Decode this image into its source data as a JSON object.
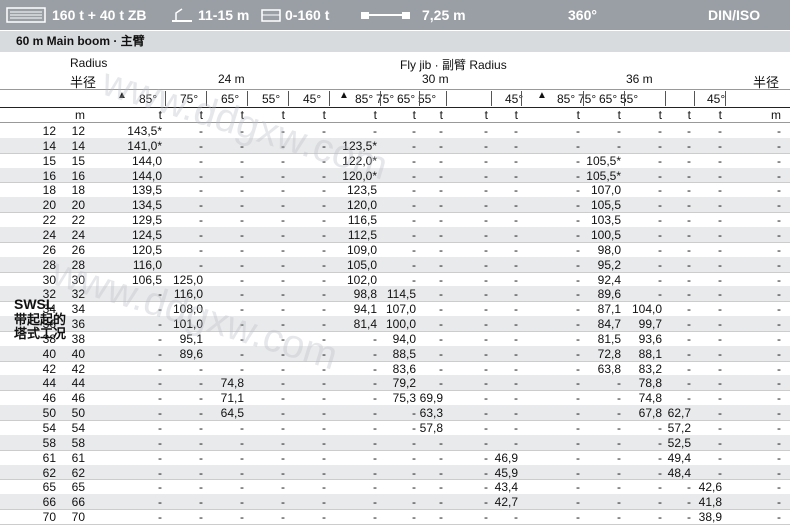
{
  "header": {
    "capacity": "160 t + 40 t ZB",
    "counterweight_range": "11-15 m",
    "ballast": "0-160 t",
    "outrigger": "7,25 m",
    "slew": "360°",
    "standard": "DIN/ISO"
  },
  "subheader": {
    "boom": "60 m   Main boom · 主臂"
  },
  "table": {
    "radius_label_en": "Radius",
    "radius_label_cn": "半径",
    "radius_label_cn_right": "半径",
    "flyjib_label": "Fly jib · 副臂 Radius",
    "groups": [
      "24 m",
      "30 m",
      "36 m"
    ],
    "angles_24": [
      "85°",
      "75°",
      "65°",
      "55°",
      "45°"
    ],
    "angles_30": [
      "85°",
      "75°",
      "65°",
      "55°",
      "45°"
    ],
    "angles_36": [
      "85°",
      "75°",
      "65°",
      "55°",
      "45°"
    ],
    "unit_left": "m",
    "unit_right": "m",
    "unit_t": "t",
    "swsl": "SWSL",
    "swsl_cn1": "带起起的",
    "swsl_cn2": "塔式工况",
    "rows": [
      [
        "12",
        "143,5*",
        "-",
        "-",
        "-",
        "-",
        "-",
        "-",
        "-",
        "-",
        "-",
        "-",
        "-",
        "-",
        "-",
        "-",
        "-",
        "12"
      ],
      [
        "14",
        "141,0*",
        "-",
        "-",
        "-",
        "-",
        "123,5*",
        "-",
        "-",
        "-",
        "-",
        "-",
        "-",
        "-",
        "-",
        "-",
        "-",
        "14"
      ],
      [
        "15",
        "144,0",
        "-",
        "-",
        "-",
        "-",
        "122,0*",
        "-",
        "-",
        "-",
        "-",
        "-",
        "105,5*",
        "-",
        "-",
        "-",
        "-",
        "15"
      ],
      [
        "16",
        "144,0",
        "-",
        "-",
        "-",
        "-",
        "120,0*",
        "-",
        "-",
        "-",
        "-",
        "-",
        "105,5*",
        "-",
        "-",
        "-",
        "-",
        "16"
      ],
      [
        "18",
        "139,5",
        "-",
        "-",
        "-",
        "-",
        "123,5",
        "-",
        "-",
        "-",
        "-",
        "-",
        "107,0",
        "-",
        "-",
        "-",
        "-",
        "18"
      ],
      [
        "20",
        "134,5",
        "-",
        "-",
        "-",
        "-",
        "120,0",
        "-",
        "-",
        "-",
        "-",
        "-",
        "105,5",
        "-",
        "-",
        "-",
        "-",
        "20"
      ],
      [
        "22",
        "129,5",
        "-",
        "-",
        "-",
        "-",
        "116,5",
        "-",
        "-",
        "-",
        "-",
        "-",
        "103,5",
        "-",
        "-",
        "-",
        "-",
        "22"
      ],
      [
        "24",
        "124,5",
        "-",
        "-",
        "-",
        "-",
        "112,5",
        "-",
        "-",
        "-",
        "-",
        "-",
        "100,5",
        "-",
        "-",
        "-",
        "-",
        "24"
      ],
      [
        "26",
        "120,5",
        "-",
        "-",
        "-",
        "-",
        "109,0",
        "-",
        "-",
        "-",
        "-",
        "-",
        "98,0",
        "-",
        "-",
        "-",
        "-",
        "26"
      ],
      [
        "28",
        "116,0",
        "-",
        "-",
        "-",
        "-",
        "105,0",
        "-",
        "-",
        "-",
        "-",
        "-",
        "95,2",
        "-",
        "-",
        "-",
        "-",
        "28"
      ],
      [
        "30",
        "106,5",
        "125,0",
        "-",
        "-",
        "-",
        "102,0",
        "-",
        "-",
        "-",
        "-",
        "-",
        "92,4",
        "-",
        "-",
        "-",
        "-",
        "30"
      ],
      [
        "32",
        "-",
        "116,0",
        "-",
        "-",
        "-",
        "98,8",
        "114,5",
        "-",
        "-",
        "-",
        "-",
        "89,6",
        "-",
        "-",
        "-",
        "-",
        "32"
      ],
      [
        "34",
        "-",
        "108,0",
        "-",
        "-",
        "-",
        "94,1",
        "107,0",
        "-",
        "-",
        "-",
        "-",
        "87,1",
        "104,0",
        "-",
        "-",
        "-",
        "34"
      ],
      [
        "36",
        "-",
        "101,0",
        "-",
        "-",
        "-",
        "81,4",
        "100,0",
        "-",
        "-",
        "-",
        "-",
        "84,7",
        "99,7",
        "-",
        "-",
        "-",
        "36"
      ],
      [
        "38",
        "-",
        "95,1",
        "-",
        "-",
        "-",
        "-",
        "94,0",
        "-",
        "-",
        "-",
        "-",
        "81,5",
        "93,6",
        "-",
        "-",
        "-",
        "38"
      ],
      [
        "40",
        "-",
        "89,6",
        "-",
        "-",
        "-",
        "-",
        "88,5",
        "-",
        "-",
        "-",
        "-",
        "72,8",
        "88,1",
        "-",
        "-",
        "-",
        "40"
      ],
      [
        "42",
        "-",
        "-",
        "-",
        "-",
        "-",
        "-",
        "83,6",
        "-",
        "-",
        "-",
        "-",
        "63,8",
        "83,2",
        "-",
        "-",
        "-",
        "42"
      ],
      [
        "44",
        "-",
        "-",
        "74,8",
        "-",
        "-",
        "-",
        "79,2",
        "-",
        "-",
        "-",
        "-",
        "-",
        "78,8",
        "-",
        "-",
        "-",
        "44"
      ],
      [
        "46",
        "-",
        "-",
        "71,1",
        "-",
        "-",
        "-",
        "75,3",
        "69,9",
        "-",
        "-",
        "-",
        "-",
        "74,8",
        "-",
        "-",
        "-",
        "46"
      ],
      [
        "50",
        "-",
        "-",
        "64,5",
        "-",
        "-",
        "-",
        "-",
        "63,3",
        "-",
        "-",
        "-",
        "-",
        "67,8",
        "62,7",
        "-",
        "-",
        "50"
      ],
      [
        "54",
        "-",
        "-",
        "-",
        "-",
        "-",
        "-",
        "-",
        "57,8",
        "-",
        "-",
        "-",
        "-",
        "-",
        "57,2",
        "-",
        "-",
        "54"
      ],
      [
        "58",
        "-",
        "-",
        "-",
        "-",
        "-",
        "-",
        "-",
        "-",
        "-",
        "-",
        "-",
        "-",
        "-",
        "52,5",
        "-",
        "-",
        "58"
      ],
      [
        "61",
        "-",
        "-",
        "-",
        "-",
        "-",
        "-",
        "-",
        "-",
        "-",
        "46,9",
        "-",
        "-",
        "-",
        "49,4",
        "-",
        "-",
        "61"
      ],
      [
        "62",
        "-",
        "-",
        "-",
        "-",
        "-",
        "-",
        "-",
        "-",
        "-",
        "45,9",
        "-",
        "-",
        "-",
        "48,4",
        "-",
        "-",
        "62"
      ],
      [
        "65",
        "-",
        "-",
        "-",
        "-",
        "-",
        "-",
        "-",
        "-",
        "-",
        "43,4",
        "-",
        "-",
        "-",
        "-",
        "42,6",
        "-",
        "65"
      ],
      [
        "66",
        "-",
        "-",
        "-",
        "-",
        "-",
        "-",
        "-",
        "-",
        "-",
        "42,7",
        "-",
        "-",
        "-",
        "-",
        "41,8",
        "-",
        "66"
      ],
      [
        "70",
        "-",
        "-",
        "-",
        "-",
        "-",
        "-",
        "-",
        "-",
        "-",
        "-",
        "-",
        "-",
        "-",
        "-",
        "38,9",
        "-",
        "70"
      ]
    ]
  },
  "watermark": {
    "text1": "www.ddgxw.com",
    "text2": "www.ddgxw.com"
  },
  "colors": {
    "header_bg": "#9a9fa5",
    "subheader_bg": "#d8dbde",
    "band": "#e9eaec"
  }
}
